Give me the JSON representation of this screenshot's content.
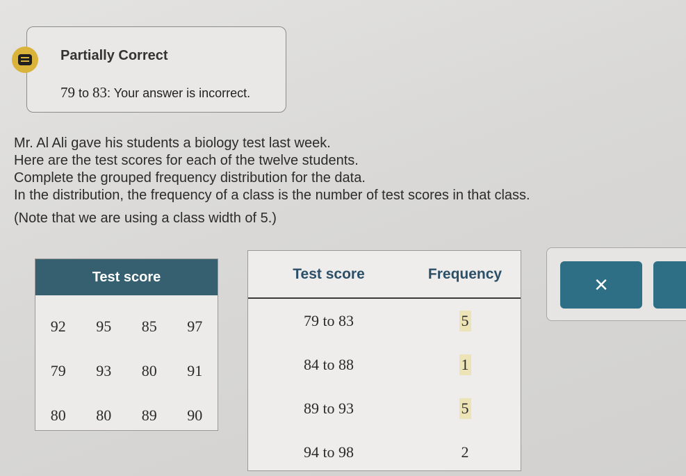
{
  "feedback": {
    "title": "Partially Correct",
    "message_num_from": "79",
    "message_to": "to",
    "message_num_to": "83",
    "message_rest": ": Your answer is incorrect.",
    "icon": "feedback-icon",
    "accent": "#d9b33a"
  },
  "problem": {
    "lines": [
      "Mr. Al Ali gave his students a biology test last week.",
      "Here are the test scores for each of the twelve students.",
      "Complete the grouped frequency distribution for the data.",
      "In the distribution, the frequency of a class is the number of test scores in that class."
    ],
    "note": "(Note that we are using a class width of 5.)"
  },
  "scores_table": {
    "header": "Test score",
    "rows": [
      [
        "92",
        "95",
        "85",
        "97"
      ],
      [
        "79",
        "93",
        "80",
        "91"
      ],
      [
        "80",
        "80",
        "89",
        "90"
      ]
    ]
  },
  "frequency_table": {
    "headers": [
      "Test score",
      "Frequency"
    ],
    "rows": [
      {
        "class": "79 to 83",
        "frequency": "5"
      },
      {
        "class": "84 to 88",
        "frequency": "1"
      },
      {
        "class": "89 to 93",
        "frequency": "5"
      },
      {
        "class": "94 to 98",
        "frequency": "2"
      }
    ]
  },
  "buttons": {
    "clear_label": "×",
    "header_color": "#36606f",
    "button_color": "#2f6f86"
  }
}
